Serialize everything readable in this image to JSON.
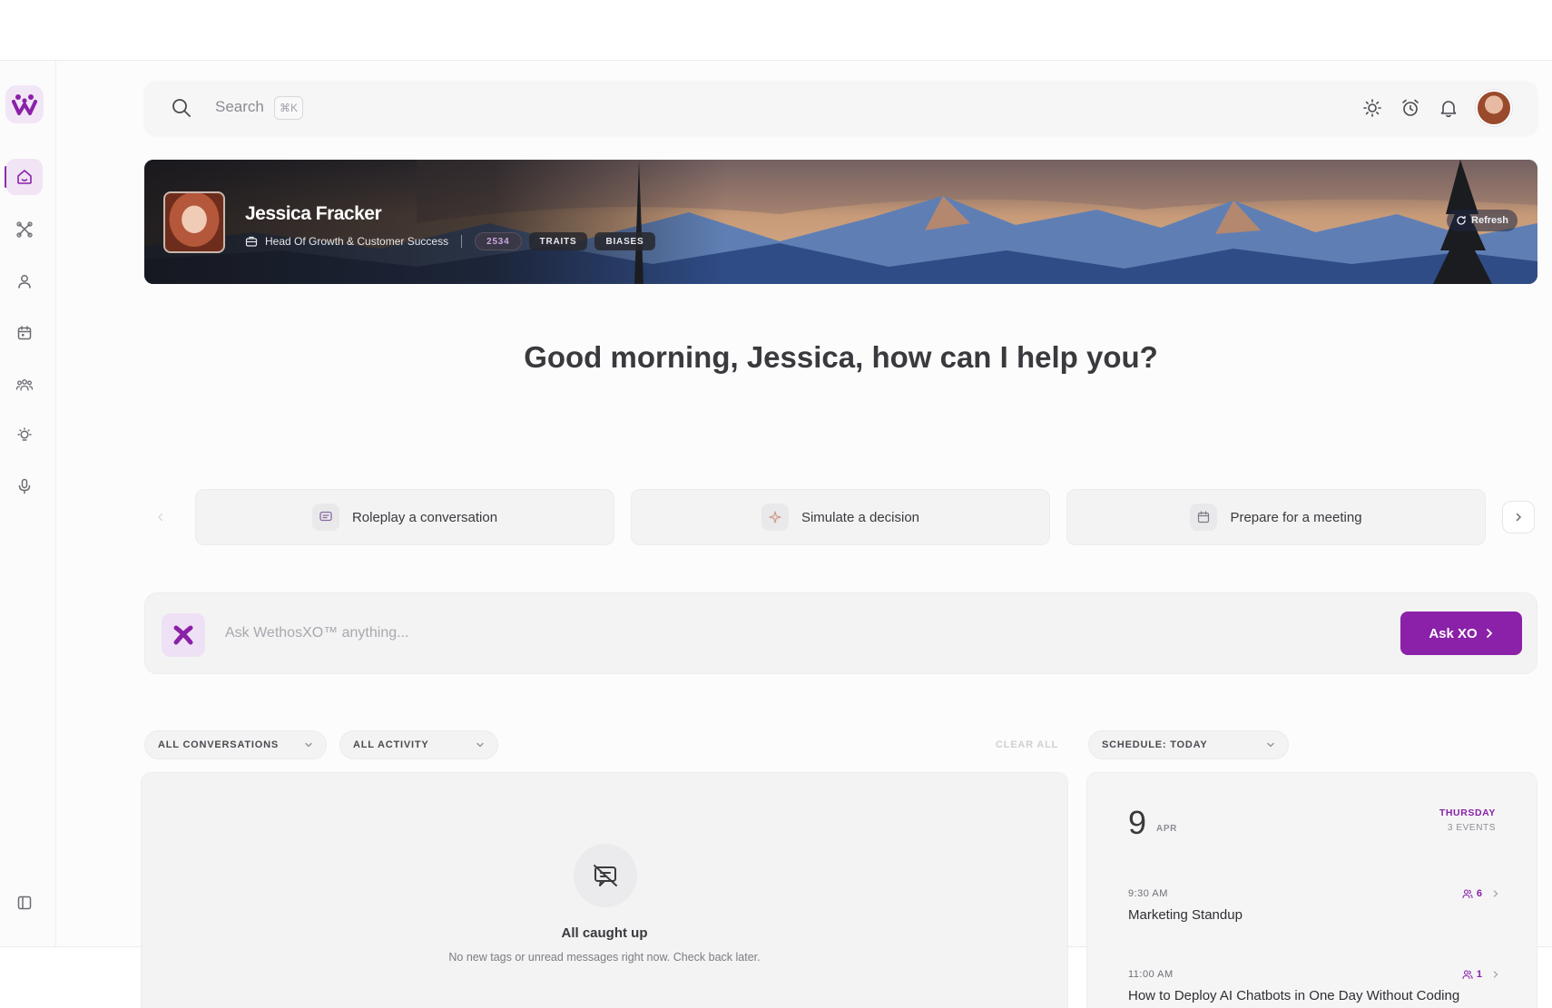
{
  "colors": {
    "accent": "#8a21a8",
    "accent_soft": "#f0e4f5"
  },
  "sidebar": {
    "logo_icon": "wethos-logo-icon",
    "items": [
      {
        "name": "home",
        "icon": "home-icon",
        "active": true
      },
      {
        "name": "xo",
        "icon": "xo-icon",
        "active": false
      },
      {
        "name": "profile",
        "icon": "user-icon",
        "active": false
      },
      {
        "name": "calendar",
        "icon": "calendar-icon",
        "active": false
      },
      {
        "name": "team",
        "icon": "team-icon",
        "active": false
      },
      {
        "name": "insights",
        "icon": "lightbulb-icon",
        "active": false
      },
      {
        "name": "voice",
        "icon": "microphone-icon",
        "active": false
      }
    ],
    "collapse_icon": "sidebar-toggle-icon"
  },
  "topbar": {
    "search_placeholder": "Search",
    "search_shortcut": "⌘K",
    "icons": [
      "sun-icon",
      "alarm-icon",
      "bell-icon"
    ]
  },
  "banner": {
    "name": "Jessica Fracker",
    "role": "Head Of Growth & Customer Success",
    "score": "2534",
    "traits_label": "TRAITS",
    "biases_label": "BIASES",
    "refresh_label": "Refresh"
  },
  "greeting": "Good morning, Jessica, how can I help you?",
  "suggestions": [
    {
      "label": "Roleplay a conversation",
      "icon": "chat-icon"
    },
    {
      "label": "Simulate a decision",
      "icon": "sparkle-icon"
    },
    {
      "label": "Prepare for a meeting",
      "icon": "calendar-icon"
    }
  ],
  "ask": {
    "placeholder": "Ask WethosXO™ anything...",
    "button_label": "Ask XO"
  },
  "filters": {
    "conversations": "ALL CONVERSATIONS",
    "activity": "ALL ACTIVITY",
    "clear_all": "CLEAR ALL",
    "schedule": "SCHEDULE: TODAY"
  },
  "inbox": {
    "empty_title": "All caught up",
    "empty_subtitle": "No new tags or unread messages right now. Check back later."
  },
  "schedule": {
    "day": "9",
    "month": "APR",
    "weekday": "THURSDAY",
    "event_count": "3 EVENTS",
    "events": [
      {
        "time": "9:30 AM",
        "title": "Marketing Standup",
        "attendees": "6"
      },
      {
        "time": "11:00 AM",
        "title": "How to Deploy AI Chatbots in One Day Without Coding",
        "attendees": "1"
      }
    ]
  }
}
